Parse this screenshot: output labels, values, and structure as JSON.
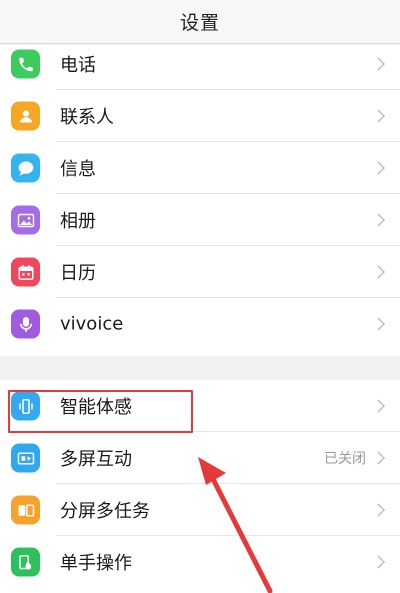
{
  "header": {
    "title": "设置"
  },
  "groups": [
    {
      "items": [
        {
          "label": "电话",
          "icon": "phone-icon",
          "color": "#3ccb5c"
        },
        {
          "label": "联系人",
          "icon": "contacts-icon",
          "color": "#f5a623"
        },
        {
          "label": "信息",
          "icon": "message-icon",
          "color": "#34b4ee"
        },
        {
          "label": "相册",
          "icon": "album-icon",
          "color": "#a56be8"
        },
        {
          "label": "日历",
          "icon": "calendar-icon",
          "color": "#f0475d"
        },
        {
          "label": "vivoice",
          "icon": "microphone-icon",
          "color": "#a05be0"
        }
      ]
    },
    {
      "items": [
        {
          "label": "智能体感",
          "icon": "motion-sense-icon",
          "color": "#35a8f2"
        },
        {
          "label": "多屏互动",
          "icon": "screen-cast-icon",
          "color": "#2fa8ee",
          "value": "已关闭"
        },
        {
          "label": "分屏多任务",
          "icon": "split-screen-icon",
          "color": "#f6a22c"
        },
        {
          "label": "单手操作",
          "icon": "one-hand-icon",
          "color": "#2ec05b"
        }
      ]
    }
  ],
  "annotations": {
    "highlight_color": "#e53a3a",
    "arrow_color": "#e53a3a"
  }
}
